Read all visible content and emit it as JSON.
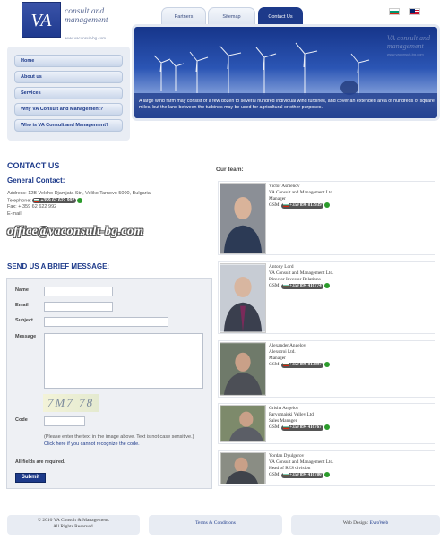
{
  "logo": {
    "initials": "VA",
    "name_line1": "consult and",
    "name_line2": "management",
    "url": "www.vaconsult-bg.com"
  },
  "tabs": [
    {
      "label": "Partners",
      "active": false
    },
    {
      "label": "Sitemap",
      "active": false
    },
    {
      "label": "Contact Us",
      "active": true
    }
  ],
  "languages": [
    "Bulgarian",
    "English"
  ],
  "menu": [
    "Home",
    "About us",
    "Services",
    "Why VA Consult and Management?",
    "Who is VA Consult and Management?"
  ],
  "banner": {
    "logo_line1": "VA consult and",
    "logo_line2": "management",
    "logo_url": "www.vaconsult-bg.com",
    "caption": "A large wind farm may consist of a few dozen to several hundred individual wind turbines, and cover an extended area of hundreds of square miles, but the land between the turbines may be used for agricultural or other purposes."
  },
  "contact": {
    "title": "CONTACT US",
    "general_title": "General Contact:",
    "address": "Address: 12B Velcho Djamjata Str., Veliko Tarnovo 5000, Bulgaria",
    "telephone_label": "Telephone:",
    "telephone": "+359 62 622 992",
    "fax": "Fax: + 359 62 622 992",
    "email_label": "E-mail:",
    "email": "office@vaconsult-bg.com"
  },
  "form": {
    "title": "SEND US A BRIEF MESSAGE:",
    "name_label": "Name",
    "email_label": "Email",
    "subject_label": "Subject",
    "message_label": "Message",
    "captcha_text": "7M7 78",
    "code_label": "Code",
    "hint": "(Please enter the text in the image above. Text is not case sensitive.)",
    "hint_link": "Click here if you cannot recognize the code.",
    "required": "All fields are required.",
    "submit": "Submit"
  },
  "team": {
    "title": "Our team:",
    "members": [
      {
        "name": "Victor Asmenov",
        "company": "VA Consult and Management Ltd.",
        "role": "Manager",
        "gsm_label": "GSM:",
        "gsm": "+359 896 813939"
      },
      {
        "name": "Antony Lord",
        "company": "VA Consult and Management Ltd.",
        "role": "Director Investor Relations",
        "gsm_label": "GSM:",
        "gsm": "+359 894 416774"
      },
      {
        "name": "Alexander Angelov",
        "company": "Alexstroi Ltd.",
        "role": "Manager",
        "gsm_label": "GSM:",
        "gsm": "+359 896 813897"
      },
      {
        "name": "Grisha Angelov",
        "company": "Parvomaiski Valley Ltd.",
        "role": "Sales Manager",
        "gsm_label": "GSM:",
        "gsm": "+359 894 416767"
      },
      {
        "name": "Yordan Dyulgerov",
        "company": "VA Consult and Management Ltd.",
        "role": "Head of RES division",
        "gsm_label": "GSM:",
        "gsm": "+359 894 416780"
      }
    ]
  },
  "footer": {
    "copyright_line1": "© 2010 VA Consult & Management.",
    "copyright_line2": "All Rights Reserved.",
    "terms": "Terms & Conditions",
    "design_label": "Web Design:",
    "design_link": "EvroWeb"
  }
}
